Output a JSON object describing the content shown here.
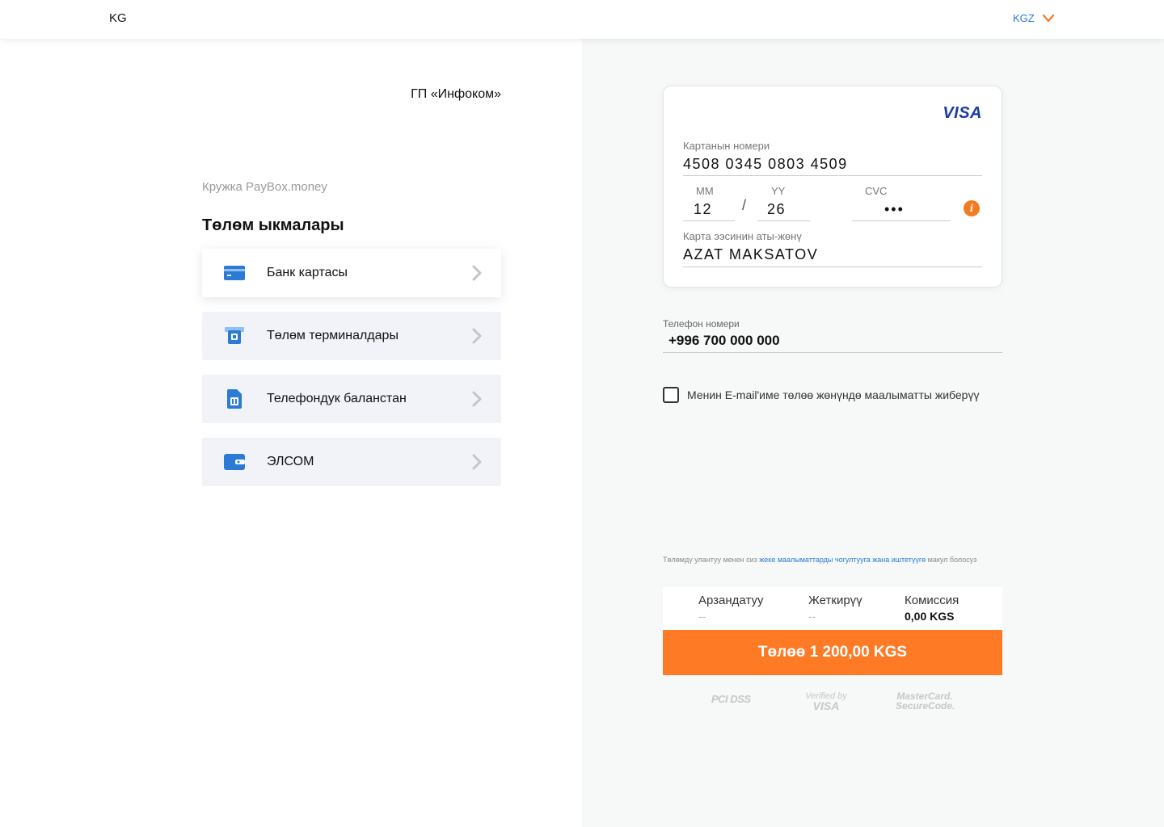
{
  "header": {
    "brand": "KG",
    "language": "KGZ"
  },
  "left": {
    "merchant": "ГП «Инфоком»",
    "order_description": "Кружка PayBox.money",
    "methods_title": "Төлөм ыкмалары",
    "methods": [
      {
        "label": "Банк картасы",
        "icon": "credit-card-icon",
        "active": true
      },
      {
        "label": "Төлөм терминалдары",
        "icon": "terminal-icon",
        "active": false
      },
      {
        "label": "Телефондук баланстан",
        "icon": "sim-card-icon",
        "active": false
      },
      {
        "label": "ЭЛСОМ",
        "icon": "wallet-icon",
        "active": false
      }
    ]
  },
  "card": {
    "brand": "VISA",
    "number_label": "Картанын номери",
    "number": "4508 0345 0803 4509",
    "mm_label": "MM",
    "mm": "12",
    "separator": "/",
    "yy_label": "YY",
    "yy": "26",
    "cvc_label": "CVC",
    "cvc": "•••",
    "holder_label": "Карта ээсинин аты-жөнү",
    "holder": "AZAT MAKSATOV",
    "info_icon": "i"
  },
  "phone": {
    "label": "Телефон номери",
    "value": "+996 700 000 000"
  },
  "email_checkbox": {
    "label": "Менин E-mail'име төлөө жөнүндө маалыматты жиберүү",
    "checked": false
  },
  "terms": {
    "prefix": "Төлөмдү улантуу менен сиз ",
    "link": "жеке маалыматтарды чогултууга жана иштетүүгө",
    "suffix": " макул болосуз"
  },
  "summary": {
    "discount_label": "Арзандатуу",
    "discount_value": "--",
    "delivery_label": "Жеткирүү",
    "delivery_value": "--",
    "commission_label": "Комиссия",
    "commission_value": "0,00 KGS"
  },
  "pay_button": "Төлөө 1 200,00 KGS",
  "security_badges": {
    "pci": "PCI DSS",
    "verified_line1": "Verified by",
    "verified_line2": "VISA",
    "mc_line1": "MasterCard.",
    "mc_line2": "SecureCode."
  },
  "colors": {
    "accent": "#ff7a24",
    "link": "#2a7ad6",
    "icon_blue": "#2a7ad6",
    "visa": "#1a3aa8"
  }
}
